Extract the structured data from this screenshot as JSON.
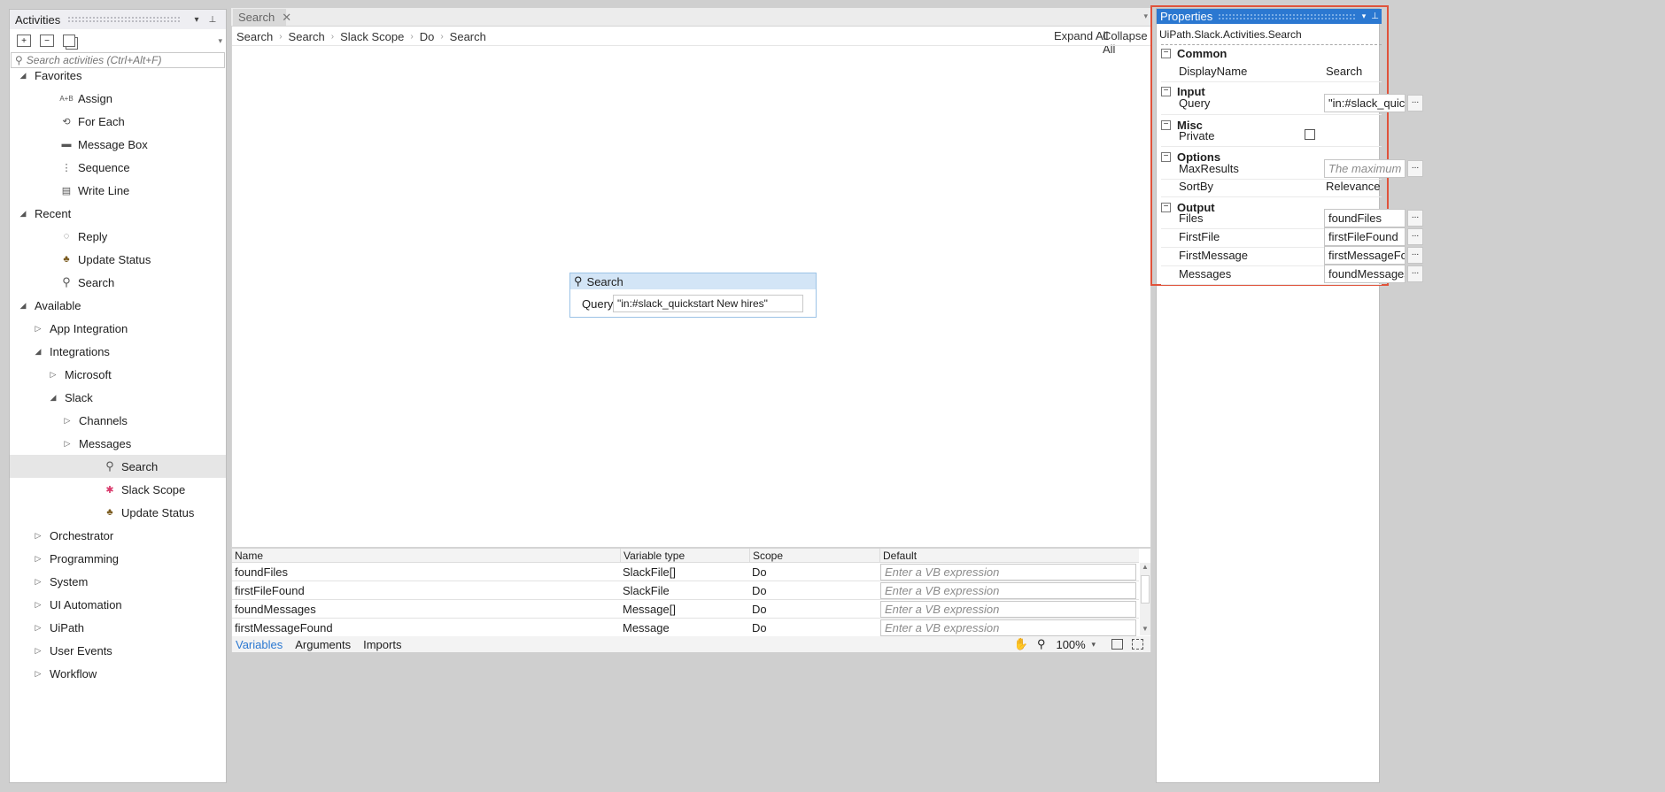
{
  "activities": {
    "title": "Activities",
    "search_placeholder": "Search activities (Ctrl+Alt+F)",
    "tree": [
      {
        "label": "Favorites",
        "level": 0,
        "arrow": "expanded"
      },
      {
        "label": "Assign",
        "level": 1,
        "icon": "assign-icon",
        "glyph": "A+B"
      },
      {
        "label": "For Each",
        "level": 1,
        "icon": "for-each-icon",
        "glyph": "⟲"
      },
      {
        "label": "Message Box",
        "level": 1,
        "icon": "message-box-icon",
        "glyph": "▬"
      },
      {
        "label": "Sequence",
        "level": 1,
        "icon": "sequence-icon",
        "glyph": "⋮"
      },
      {
        "label": "Write Line",
        "level": 1,
        "icon": "write-line-icon",
        "glyph": "▤"
      },
      {
        "label": "Recent",
        "level": 0,
        "arrow": "expanded"
      },
      {
        "label": "Reply",
        "level": 1,
        "icon": "reply-icon",
        "glyph": "◌"
      },
      {
        "label": "Update Status",
        "level": 1,
        "icon": "palm-tree-icon",
        "glyph": "♣"
      },
      {
        "label": "Search",
        "level": 1,
        "icon": "search-icon",
        "glyph": "⚲"
      },
      {
        "label": "Available",
        "level": 0,
        "arrow": "expanded"
      },
      {
        "label": "App Integration",
        "level": 1,
        "arrow": "collapsed"
      },
      {
        "label": "Integrations",
        "level": 1,
        "arrow": "expanded"
      },
      {
        "label": "Microsoft",
        "level": 2,
        "arrow": "collapsed"
      },
      {
        "label": "Slack",
        "level": 2,
        "arrow": "expanded"
      },
      {
        "label": "Channels",
        "level": 3,
        "arrow": "collapsed"
      },
      {
        "label": "Messages",
        "level": 3,
        "arrow": "collapsed"
      },
      {
        "label": "Search",
        "level": 4,
        "icon": "search-icon",
        "glyph": "⚲",
        "selected": true
      },
      {
        "label": "Slack Scope",
        "level": 4,
        "icon": "slack-icon",
        "glyph": "✱"
      },
      {
        "label": "Update Status",
        "level": 4,
        "icon": "palm-tree-icon",
        "glyph": "♣"
      },
      {
        "label": "Orchestrator",
        "level": 1,
        "arrow": "collapsed"
      },
      {
        "label": "Programming",
        "level": 1,
        "arrow": "collapsed"
      },
      {
        "label": "System",
        "level": 1,
        "arrow": "collapsed"
      },
      {
        "label": "UI Automation",
        "level": 1,
        "arrow": "collapsed"
      },
      {
        "label": "UiPath",
        "level": 1,
        "arrow": "collapsed"
      },
      {
        "label": "User Events",
        "level": 1,
        "arrow": "collapsed"
      },
      {
        "label": "Workflow",
        "level": 1,
        "arrow": "collapsed"
      }
    ]
  },
  "designer": {
    "tab": "Search",
    "breadcrumb": [
      "Search",
      "Search",
      "Slack Scope",
      "Do",
      "Search"
    ],
    "expand_all": "Expand All",
    "collapse_all": "Collapse All",
    "activity": {
      "title": "Search",
      "query_label": "Query",
      "query_value": "\"in:#slack_quickstart New hires\""
    },
    "variables": {
      "headers": [
        "Name",
        "Variable type",
        "Scope",
        "Default"
      ],
      "rows": [
        {
          "name": "foundFiles",
          "type": "SlackFile[]",
          "scope": "Do",
          "default": "Enter a VB expression"
        },
        {
          "name": "firstFileFound",
          "type": "SlackFile",
          "scope": "Do",
          "default": "Enter a VB expression"
        },
        {
          "name": "foundMessages",
          "type": "Message[]",
          "scope": "Do",
          "default": "Enter a VB expression"
        },
        {
          "name": "firstMessageFound",
          "type": "Message",
          "scope": "Do",
          "default": "Enter a VB expression"
        }
      ]
    },
    "bottom_tabs": [
      "Variables",
      "Arguments",
      "Imports"
    ],
    "zoom": "100%"
  },
  "properties": {
    "title": "Properties",
    "type_name": "UiPath.Slack.Activities.Search",
    "categories": {
      "common": "Common",
      "input": "Input",
      "misc": "Misc",
      "options": "Options",
      "output": "Output"
    },
    "rows": {
      "display_name": {
        "name": "DisplayName",
        "value": "Search"
      },
      "query": {
        "name": "Query",
        "value": "\"in:#slack_quick"
      },
      "private": {
        "name": "Private"
      },
      "max_results": {
        "name": "MaxResults",
        "placeholder": "The maximum r"
      },
      "sort_by": {
        "name": "SortBy",
        "value": "Relevance"
      },
      "files": {
        "name": "Files",
        "value": "foundFiles"
      },
      "first_file": {
        "name": "FirstFile",
        "value": "firstFileFound"
      },
      "first_message": {
        "name": "FirstMessage",
        "value": "firstMessageFo"
      },
      "messages": {
        "name": "Messages",
        "value": "foundMessages"
      }
    },
    "ellipsis": "...",
    "highlight_color": "#e0533b",
    "header_color": "#2b78d1"
  }
}
